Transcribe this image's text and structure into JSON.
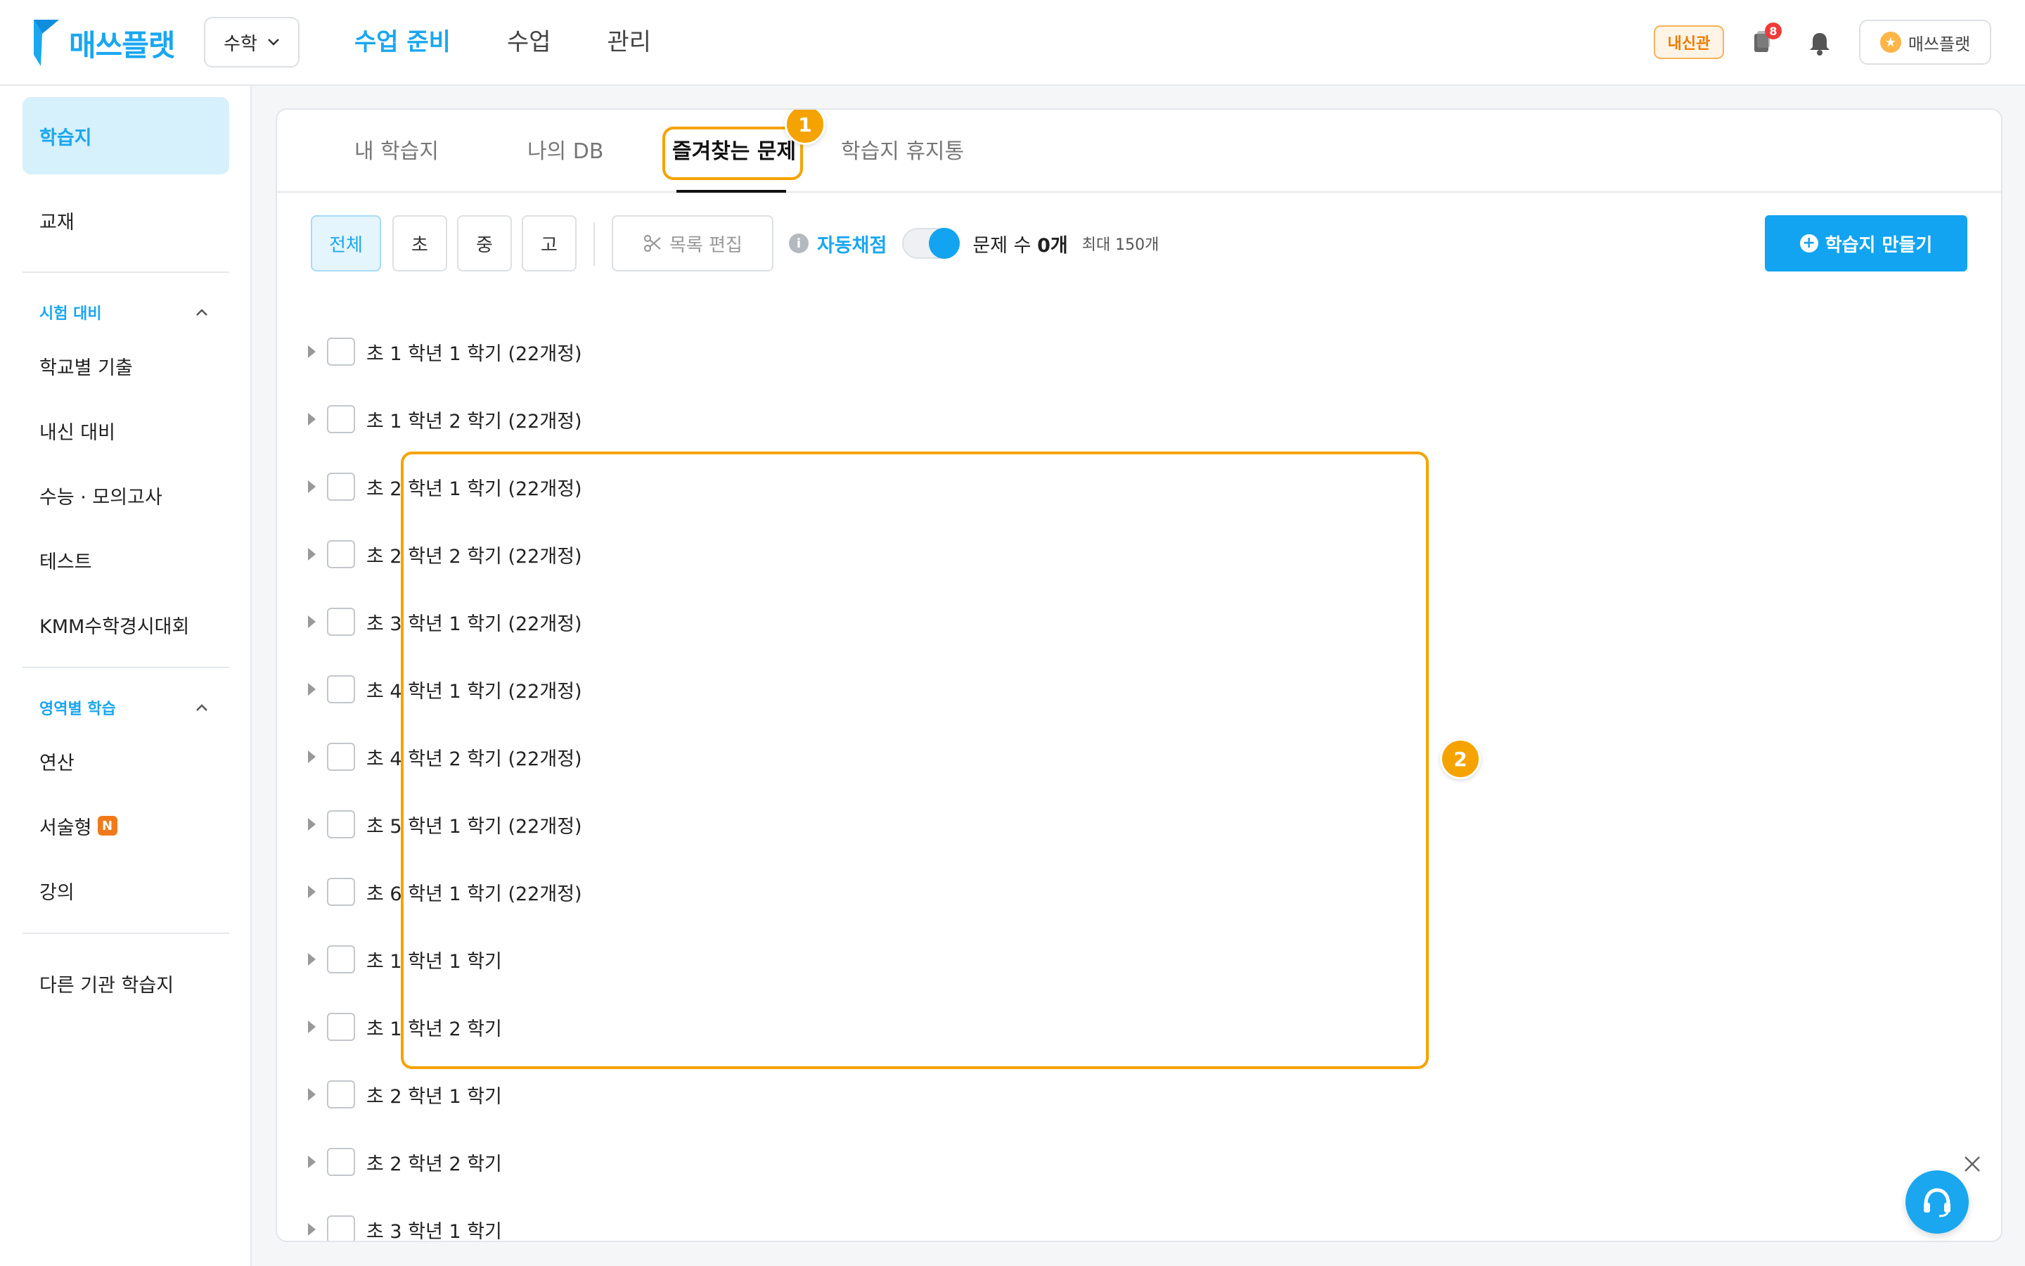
{
  "header": {
    "logo_text": "매쓰플랫",
    "subject": "수학",
    "nav": [
      "수업 준비",
      "수업",
      "관리"
    ],
    "badge": "내신관",
    "notification_count": "8",
    "user_name": "매쓰플랫"
  },
  "sidebar": {
    "top_items": [
      "학습지",
      "교재"
    ],
    "section1": {
      "title": "시험 대비",
      "items": [
        "학교별 기출",
        "내신 대비",
        "수능 · 모의고사",
        "테스트",
        "KMM수학경시대회"
      ]
    },
    "section2": {
      "title": "영역별 학습",
      "items": [
        "연산",
        "서술형",
        "강의"
      ],
      "new_badge": "N"
    },
    "bottom_item": "다른 기관 학습지"
  },
  "tabs": [
    "내 학습지",
    "나의 DB",
    "즐겨찾는 문제",
    "학습지 휴지통"
  ],
  "callouts": [
    "1",
    "2"
  ],
  "toolbar": {
    "filters": [
      "전체",
      "초",
      "중",
      "고"
    ],
    "edit_label": "목록 편집",
    "auto_grade_label": "자동채점",
    "question_count_prefix": "문제 수 ",
    "question_count_value": "0개",
    "max_label": "최대 150개",
    "create_label": "학습지 만들기"
  },
  "list_items": [
    "초 1 학년 1 학기 (22개정)",
    "초 1 학년 2 학기 (22개정)",
    "초 2 학년 1 학기 (22개정)",
    "초 2 학년 2 학기 (22개정)",
    "초 3 학년 1 학기 (22개정)",
    "초 4 학년 1 학기 (22개정)",
    "초 4 학년 2 학기 (22개정)",
    "초 5 학년 1 학기 (22개정)",
    "초 6 학년 1 학기 (22개정)",
    "초 1 학년 1 학기",
    "초 1 학년 2 학기",
    "초 2 학년 1 학기",
    "초 2 학년 2 학기",
    "초 3 학년 1 학기"
  ]
}
